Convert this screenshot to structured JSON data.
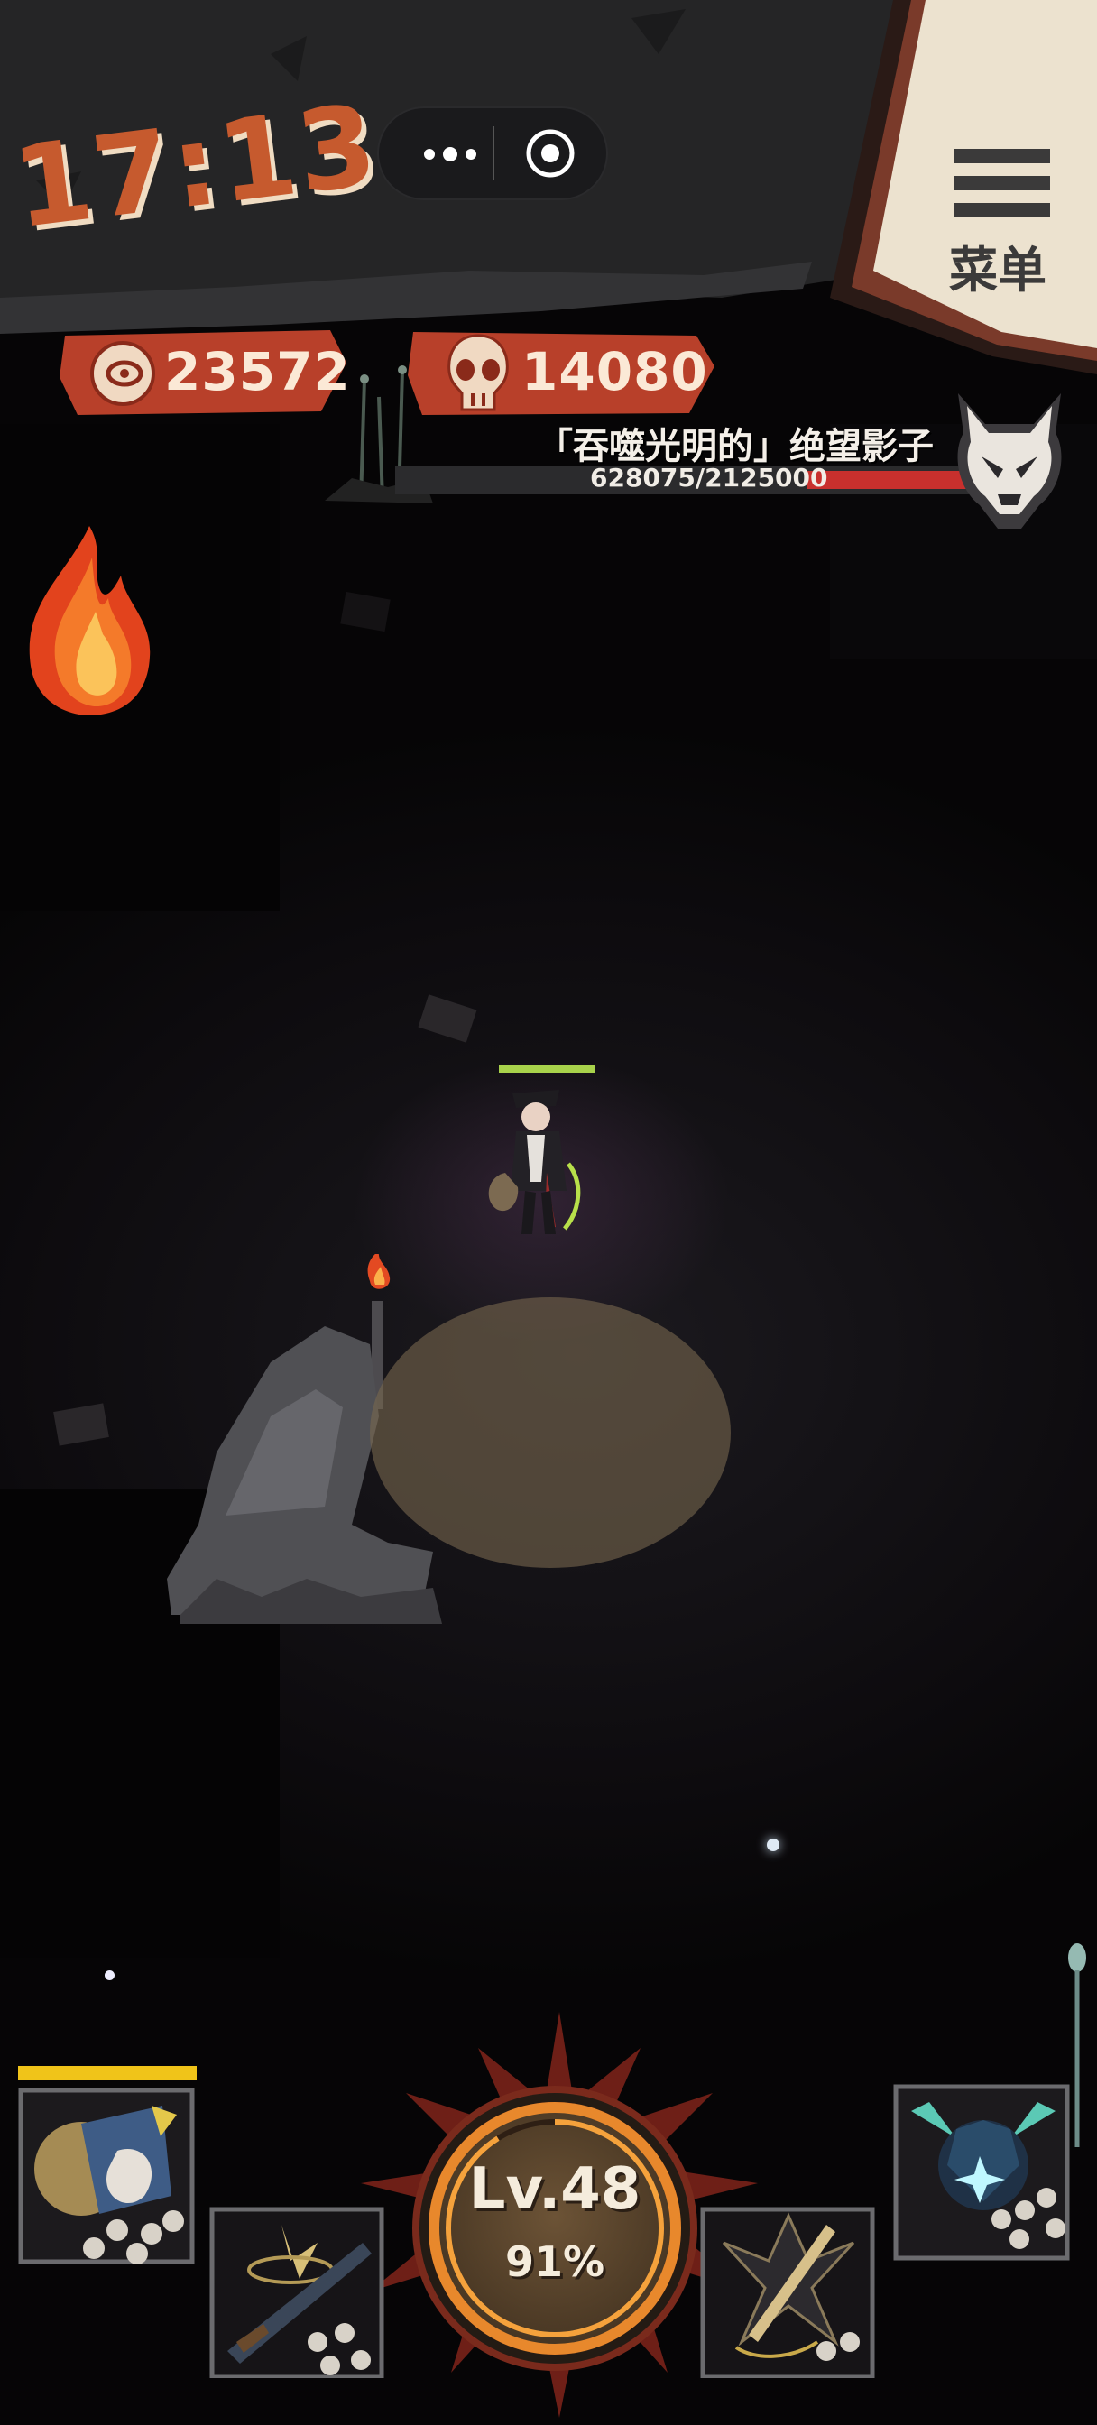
{
  "status": {
    "clock": "17:13"
  },
  "capsule": {
    "more_icon": "more-dots-icon",
    "close_icon": "target-close-icon"
  },
  "menu": {
    "label": "菜单",
    "icon": "hamburger-icon"
  },
  "resources": {
    "coins": {
      "value": "23572",
      "icon": "eye-coin-icon"
    },
    "skulls": {
      "value": "14080",
      "icon": "skull-icon"
    }
  },
  "boss": {
    "name": "「吞噬光明的」绝望影子",
    "hp_text": "628075/2125000",
    "hp_fraction": 0.2956,
    "icon": "horned-demon-skull-icon"
  },
  "hero": {
    "hp_fraction": 1.0
  },
  "bottom": {
    "level_label": "Lv.48",
    "level_percent_label": "91%",
    "level_fraction": 0.91,
    "xp_bar_fraction": 1.0,
    "slots": [
      {
        "icon": "cat-gunner-hero-icon"
      },
      {
        "icon": "rifle-weapon-icon"
      },
      {
        "icon": "sword-weapon-icon"
      },
      {
        "icon": "crystal-spirit-hero-icon"
      }
    ]
  },
  "colors": {
    "accent": "#c65a2e",
    "boss_hp": "#c8302d",
    "xp": "#f0c419",
    "hero_hp": "#a8d24b"
  }
}
